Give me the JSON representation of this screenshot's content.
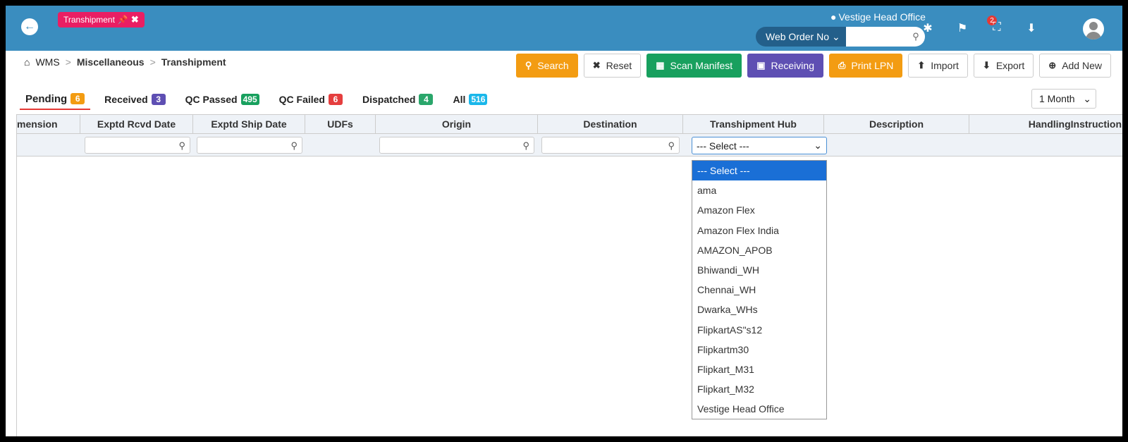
{
  "page_tag": "Transhipment",
  "header": {
    "location": "Vestige Head Office",
    "order_select": "Web Order No",
    "order_input": "",
    "notification_count": "2"
  },
  "breadcrumb": {
    "home": "WMS",
    "section": "Miscellaneous",
    "current": "Transhipment"
  },
  "toolbar": {
    "search": "Search",
    "reset": "Reset",
    "scan_manifest": "Scan Manifest",
    "receiving": "Receiving",
    "print_lpn": "Print LPN",
    "import": "Import",
    "export": "Export",
    "add_new": "Add New"
  },
  "tabs": [
    {
      "label": "Pending",
      "count": "6",
      "color": "#f39c12"
    },
    {
      "label": "Received",
      "count": "3",
      "color": "#5e4fb3"
    },
    {
      "label": "QC Passed",
      "count": "495",
      "color": "#18a05e"
    },
    {
      "label": "QC Failed",
      "count": "6",
      "color": "#e53e3e"
    },
    {
      "label": "Dispatched",
      "count": "4",
      "color": "#2aa66b"
    },
    {
      "label": "All",
      "count": "516",
      "color": "#1ab7ea"
    }
  ],
  "period": "1 Month",
  "columns": [
    "mension",
    "Exptd Rcvd Date",
    "Exptd Ship Date",
    "UDFs",
    "Origin",
    "Destination",
    "Transhipment Hub",
    "Description",
    "HandlingInstruction"
  ],
  "hub_filter": {
    "selected": "--- Select ---",
    "options": [
      "--- Select ---",
      "ama",
      "Amazon Flex",
      "Amazon Flex India",
      "AMAZON_APOB",
      "Bhiwandi_WH",
      "Chennai_WH",
      "Dwarka_WHs",
      "FlipkartAS\"s12",
      "Flipkartm30",
      "Flipkart_M31",
      "Flipkart_M32",
      "Vestige Head Office"
    ]
  }
}
